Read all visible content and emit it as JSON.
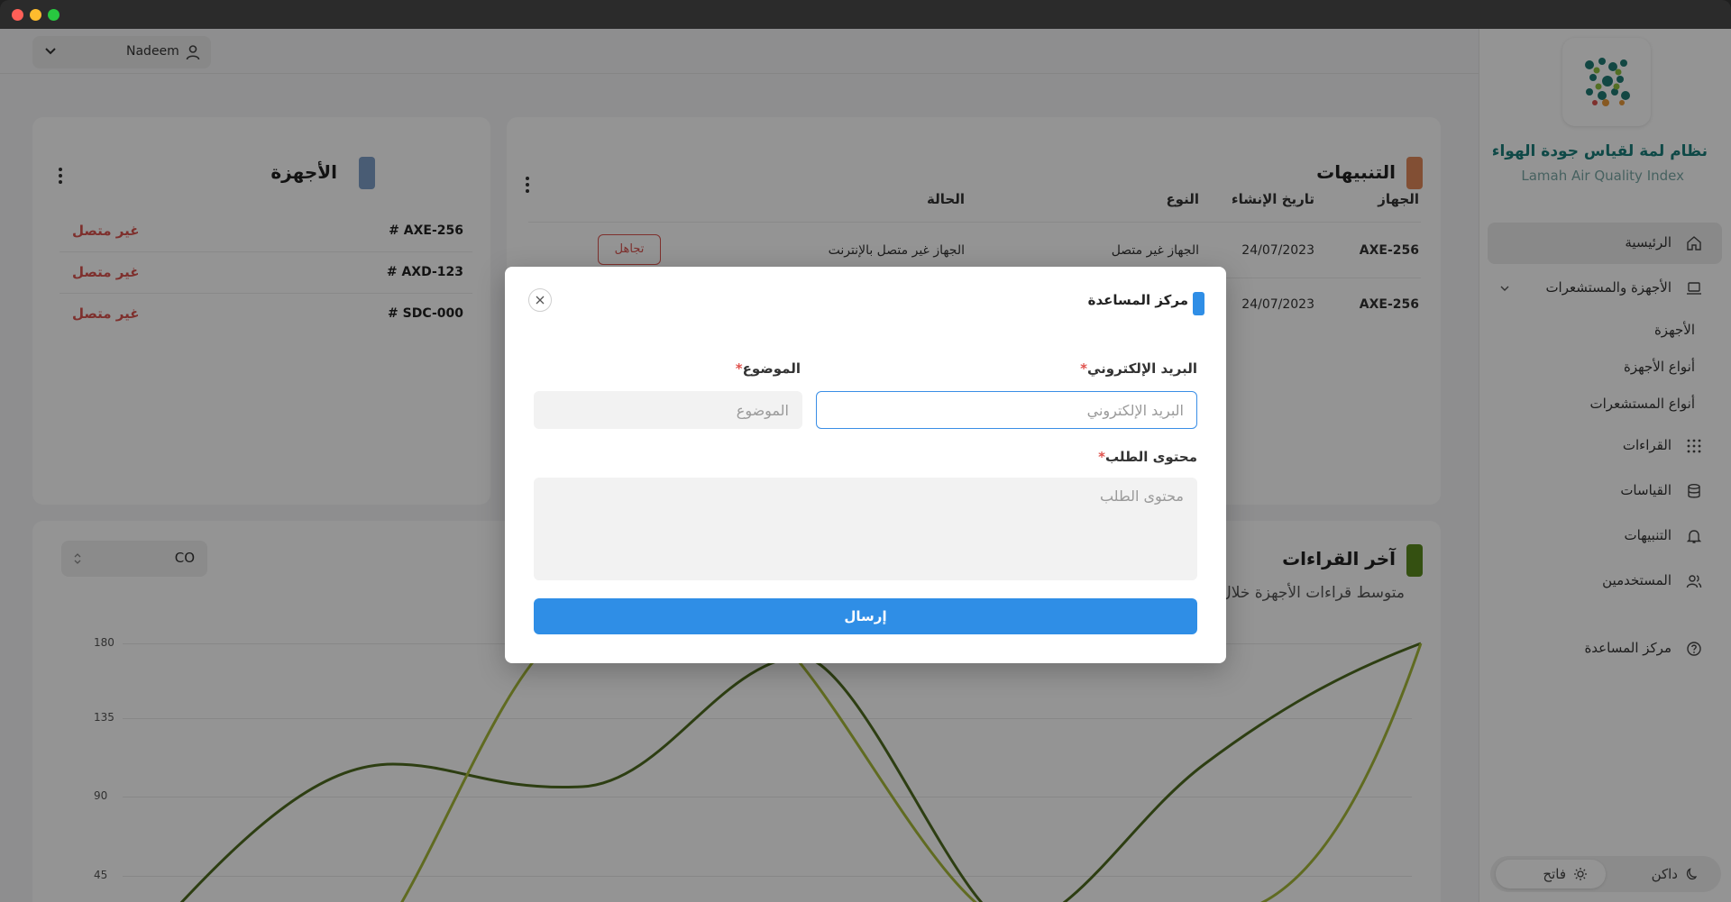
{
  "window": {
    "controls": [
      "close",
      "minimize",
      "maximize"
    ]
  },
  "topbar": {
    "user_name": "Nadeem",
    "icons": [
      "chevron-down-icon",
      "user-icon"
    ]
  },
  "sidebar": {
    "brand_ar": "نظام لمة لقياس جودة الهواء",
    "brand_en": "Lamah Air Quality Index",
    "items": [
      {
        "label": "الرئيسية",
        "icon": "home-icon",
        "active": true
      },
      {
        "label": "الأجهزة والمستشعرات",
        "icon": "laptop-icon",
        "expanded": true
      },
      {
        "label": "القراءات",
        "icon": "grid-icon"
      },
      {
        "label": "القياسات",
        "icon": "database-icon"
      },
      {
        "label": "التنبيهات",
        "icon": "bell-icon"
      },
      {
        "label": "المستخدمين",
        "icon": "users-icon"
      },
      {
        "label": "مركز المساعدة",
        "icon": "help-icon"
      }
    ],
    "sub_items": [
      "الأجهزة",
      "أنواع الأجهزة",
      "أنواع المستشعرات"
    ],
    "theme": {
      "dark": "داكن",
      "light": "فاتح",
      "selected": "light"
    }
  },
  "devices": {
    "title": "الأجهزة",
    "accent": "#7f9fc8",
    "rows": [
      {
        "name": "# AXE-256",
        "status": "غير متصل"
      },
      {
        "name": "# AXD-123",
        "status": "غير متصل"
      },
      {
        "name": "# SDC-000",
        "status": "غير متصل"
      }
    ]
  },
  "alerts": {
    "title": "التنبيهات",
    "accent": "#e0895a",
    "columns": [
      "الجهاز",
      "تاريخ الإنشاء",
      "النوع",
      "الحالة"
    ],
    "rows": [
      {
        "device": "AXE-256",
        "date": "24/07/2023",
        "type": "الجهاز غير متصل",
        "status": "الجهاز غير متصل بالإنترنت",
        "action": "تجاهل"
      },
      {
        "device": "AXE-256",
        "date": "24/07/2023",
        "type": "",
        "status": "",
        "action": ""
      }
    ]
  },
  "readings": {
    "title": "آخر القراءات",
    "subtitle": "متوسط قراءات الأجهزة خلال",
    "accent": "#5a8a1e",
    "selected_metric": "CO"
  },
  "chart_data": {
    "type": "line",
    "y_ticks": [
      180,
      135,
      90,
      45
    ],
    "ylim": [
      0,
      180
    ],
    "grid": true,
    "series": [
      {
        "color": "#4f6b1f"
      },
      {
        "color": "#a6b83a"
      }
    ]
  },
  "help_modal": {
    "title": "مركز المساعدة",
    "accent": "#2f8ee6",
    "email_label": "البريد الإلكتروني",
    "email_placeholder": "البريد الإلكتروني",
    "subject_label": "الموضوع",
    "subject_placeholder": "الموضوع",
    "content_label": "محتوى الطلب",
    "content_placeholder": "محتوى الطلب",
    "required_mark": "*",
    "submit_label": "إرسال"
  }
}
